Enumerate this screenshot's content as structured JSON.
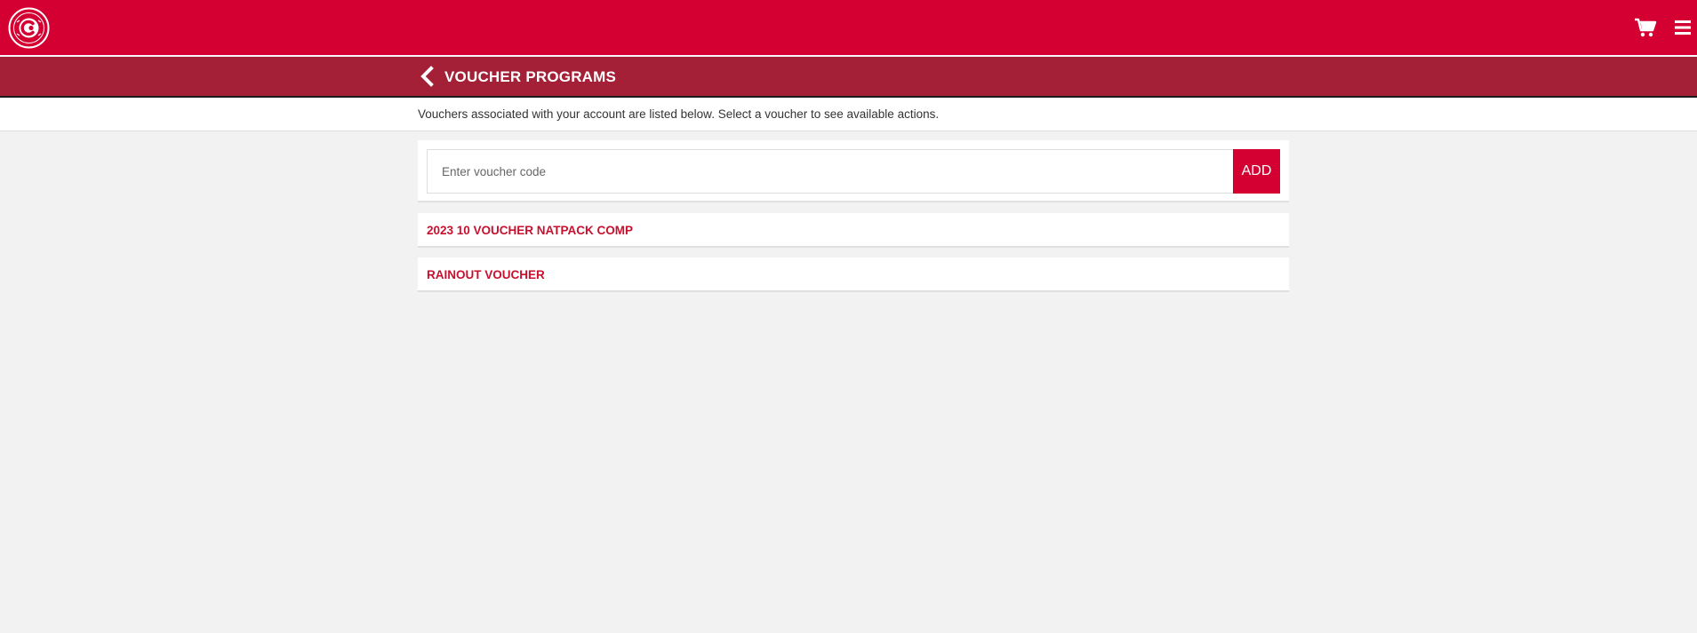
{
  "header": {
    "logo_icon": "canadians-baseball-logo-icon",
    "cart_icon": "shopping-cart-icon",
    "menu_icon": "hamburger-menu-icon",
    "brand_color": "#d50032"
  },
  "title_bar": {
    "back_icon": "chevron-left-icon",
    "title": "VOUCHER PROGRAMS",
    "color": "#a32036"
  },
  "info": {
    "text": "Vouchers associated with your account are listed below. Select a voucher to see available actions."
  },
  "add_voucher": {
    "input_value": "",
    "placeholder": "Enter voucher code",
    "button_label": "ADD"
  },
  "vouchers": [
    {
      "name": "2023 10 VOUCHER NATPACK COMP"
    },
    {
      "name": "RAINOUT VOUCHER"
    }
  ]
}
